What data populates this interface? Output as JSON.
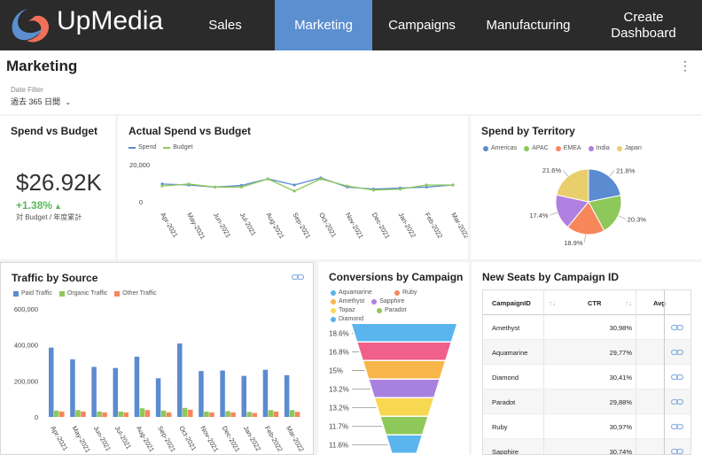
{
  "nav": {
    "brand": "UpMedia",
    "items": [
      {
        "label": "Sales",
        "active": false
      },
      {
        "label": "Marketing",
        "active": true
      },
      {
        "label": "Campaigns",
        "active": false
      },
      {
        "label": "Manufacturing",
        "active": false
      },
      {
        "label": "Create Dashboard",
        "active": false
      }
    ]
  },
  "page": {
    "title": "Marketing",
    "filter_label": "Date Filter",
    "filter_value": "過去 365 日間"
  },
  "kpi": {
    "title": "Spend vs Budget",
    "value": "$26.92K",
    "delta": "+1.38%",
    "caption": "対 Budget / 年度累計"
  },
  "colors": {
    "accent": "#5b8fd0",
    "blue": "#5b8bd0",
    "green": "#8ec85a",
    "orange": "#f8865b",
    "purple": "#b07fe0",
    "yellow": "#e8cf6b",
    "navbg": "#2b2b2b"
  },
  "cards": {
    "spend_budget": {
      "title": "Actual Spend vs Budget",
      "legend": [
        "Spend",
        "Budget"
      ]
    },
    "territory": {
      "title": "Spend by Territory",
      "legend": [
        "Americas",
        "APAC",
        "EMEA",
        "India",
        "Japan"
      ]
    },
    "traffic": {
      "title": "Traffic by Source",
      "legend": [
        "Paid Traffic",
        "Organic Traffic",
        "Other Traffic"
      ]
    },
    "conversions": {
      "title": "Conversions by Campaign",
      "legend": [
        "Aquamarine",
        "Ruby",
        "Amethyst",
        "Sapphire",
        "Topaz",
        "Paradot",
        "Diamond"
      ]
    },
    "seats": {
      "title": "New Seats by Campaign ID",
      "columns": [
        "CampaignID",
        "CTR",
        "Avg"
      ],
      "rows": [
        {
          "id": "Amethyst",
          "ctr": "30,98%"
        },
        {
          "id": "Aquamarine",
          "ctr": "29,77%"
        },
        {
          "id": "Diamond",
          "ctr": "30,41%"
        },
        {
          "id": "Paradot",
          "ctr": "29,88%"
        },
        {
          "id": "Ruby",
          "ctr": "30,97%"
        },
        {
          "id": "Sapphire",
          "ctr": "30,74%"
        }
      ]
    }
  },
  "chart_data": [
    {
      "type": "line",
      "categories": [
        "Apr-2021",
        "May-2021",
        "Jun-2021",
        "Jul-2021",
        "Aug-2021",
        "Sep-2021",
        "Oct-2021",
        "Nov-2021",
        "Dec-2021",
        "Jan-2022",
        "Feb-2022",
        "Mar-2022"
      ],
      "series": [
        {
          "name": "Spend",
          "values": [
            10500,
            10000,
            9000,
            9800,
            13000,
            10000,
            13500,
            9000,
            8000,
            8500,
            9000,
            10000
          ]
        },
        {
          "name": "Budget",
          "values": [
            9500,
            10500,
            9000,
            9000,
            13000,
            7000,
            13000,
            9500,
            7500,
            8000,
            10000,
            10000
          ]
        }
      ],
      "yticks": [
        "20,000",
        "0"
      ],
      "ylim": [
        0,
        20000
      ]
    },
    {
      "type": "pie",
      "categories": [
        "Americas",
        "APAC",
        "EMEA",
        "India",
        "Japan"
      ],
      "values": [
        21.8,
        20.3,
        18.9,
        17.4,
        21.6
      ],
      "labels": [
        "21.8%",
        "20.3%",
        "18.9%",
        "17.4%",
        "21.6%"
      ]
    },
    {
      "type": "bar",
      "categories": [
        "Apr-2021",
        "May-2021",
        "Jun-2021",
        "Jul-2021",
        "Aug-2021",
        "Sep-2021",
        "Oct-2021",
        "Nov-2021",
        "Dec-2021",
        "Jan-2022",
        "Feb-2022",
        "Mar-2022"
      ],
      "series": [
        {
          "name": "Paid Traffic",
          "values": [
            385000,
            320000,
            278000,
            272000,
            335000,
            215000,
            408000,
            255000,
            258000,
            228000,
            262000,
            232000
          ]
        },
        {
          "name": "Organic Traffic",
          "values": [
            35000,
            38000,
            30000,
            30000,
            48000,
            35000,
            50000,
            30000,
            32000,
            28000,
            38000,
            38000
          ]
        },
        {
          "name": "Other Traffic",
          "values": [
            30000,
            30000,
            25000,
            25000,
            38000,
            25000,
            40000,
            25000,
            25000,
            22000,
            30000,
            28000
          ]
        }
      ],
      "yticks": [
        "600,000",
        "400,000",
        "200,000",
        "0"
      ],
      "ylim": [
        0,
        600000
      ]
    },
    {
      "type": "bar",
      "subtype": "funnel",
      "categories": [
        "Aquamarine",
        "Ruby",
        "Amethyst",
        "Sapphire",
        "Topaz",
        "Paradot",
        "Diamond"
      ],
      "labels": [
        "18.6%",
        "16.8%",
        "15%",
        "13.2%",
        "13.2%",
        "11.7%",
        "11.6%"
      ]
    }
  ]
}
